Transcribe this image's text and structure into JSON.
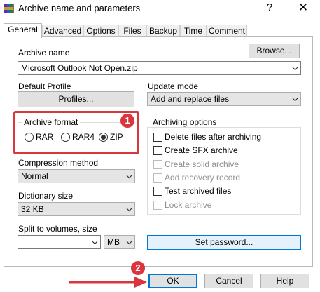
{
  "window": {
    "title": "Archive name and parameters",
    "help_glyph": "?",
    "close_glyph": "✕"
  },
  "tabs": [
    {
      "label": "General",
      "active": true
    },
    {
      "label": "Advanced"
    },
    {
      "label": "Options"
    },
    {
      "label": "Files"
    },
    {
      "label": "Backup"
    },
    {
      "label": "Time"
    },
    {
      "label": "Comment"
    }
  ],
  "archive_name": {
    "label": "Archive name",
    "browse_label": "Browse...",
    "value": "Microsoft Outlook Not Open.zip"
  },
  "default_profile": {
    "label": "Default Profile",
    "profiles_label": "Profiles..."
  },
  "update_mode": {
    "label": "Update mode",
    "value": "Add and replace files"
  },
  "archive_format": {
    "label": "Archive format",
    "options": [
      {
        "label": "RAR",
        "selected": false
      },
      {
        "label": "RAR4",
        "selected": false
      },
      {
        "label": "ZIP",
        "selected": true
      }
    ]
  },
  "archiving_options": {
    "label": "Archiving options",
    "items": [
      {
        "label": "Delete files after archiving",
        "enabled": true,
        "checked": false
      },
      {
        "label": "Create SFX archive",
        "enabled": true,
        "checked": false
      },
      {
        "label": "Create solid archive",
        "enabled": false,
        "checked": false
      },
      {
        "label": "Add recovery record",
        "enabled": false,
        "checked": false
      },
      {
        "label": "Test archived files",
        "enabled": true,
        "checked": false
      },
      {
        "label": "Lock archive",
        "enabled": false,
        "checked": false
      }
    ]
  },
  "compression_method": {
    "label": "Compression method",
    "value": "Normal"
  },
  "dictionary_size": {
    "label": "Dictionary size",
    "value": "32 KB"
  },
  "split_volumes": {
    "label": "Split to volumes, size",
    "value": "",
    "unit": "MB"
  },
  "set_password_label": "Set password...",
  "footer": {
    "ok_label": "OK",
    "cancel_label": "Cancel",
    "help_label": "Help"
  },
  "annotations": {
    "badge1": "1",
    "badge2": "2",
    "color": "#d9363e"
  },
  "colors": {
    "accent": "#0078d7",
    "annotation_red": "#d9363e"
  }
}
